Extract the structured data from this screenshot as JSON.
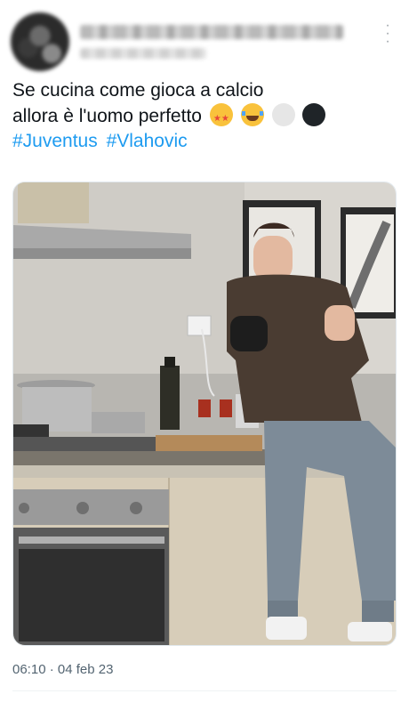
{
  "tweet": {
    "author_name": "",
    "author_handle": "",
    "more_icon": "more-vertical-icon",
    "text_line1": "Se cucina come gioca a calcio",
    "text_line2": "allora è l'uomo perfetto",
    "emojis": [
      "star-struck-emoji",
      "joy-emoji",
      "white-circle-emoji",
      "black-circle-emoji"
    ],
    "hashtags": [
      "#Juventus",
      "#Vlahovic"
    ],
    "photo": {
      "description_icon": "kitchen-photo"
    },
    "timestamp": "06:10 · 04 feb 23"
  },
  "colors": {
    "link": "#1d9bf0",
    "text": "#0f1419",
    "meta": "#536471"
  }
}
